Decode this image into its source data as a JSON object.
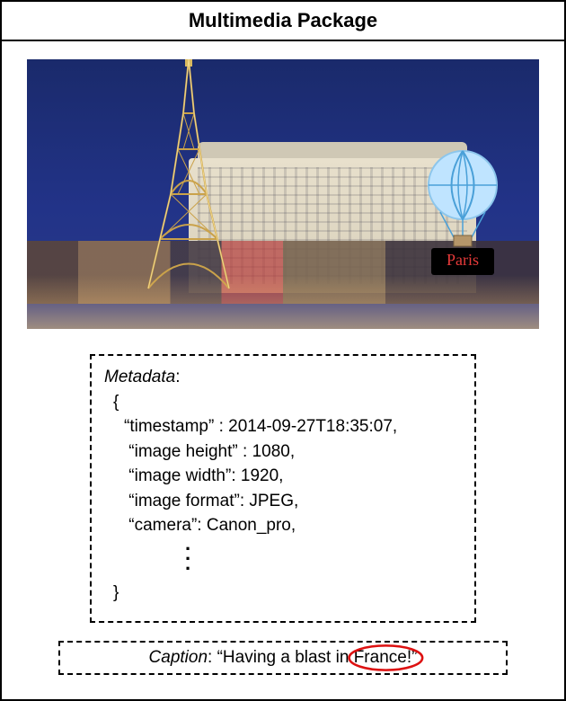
{
  "title": "Multimedia Package",
  "photo": {
    "sign_text": "Paris"
  },
  "metadata": {
    "label": "Metadata",
    "open_brace": "{",
    "close_brace": "}",
    "items": [
      {
        "key": "“timestamp”",
        "value": "2014-09-27T18:35:07,"
      },
      {
        "key": "“image height”",
        "value": "1080,"
      },
      {
        "key": "“image width”",
        "value": "1920,"
      },
      {
        "key": "“image format”",
        "value": "JPEG,"
      },
      {
        "key": "“camera”",
        "value": "Canon_pro,"
      }
    ]
  },
  "caption": {
    "label": "Caption",
    "prefix": "“Having a blast in ",
    "circled_word": "France!”"
  }
}
